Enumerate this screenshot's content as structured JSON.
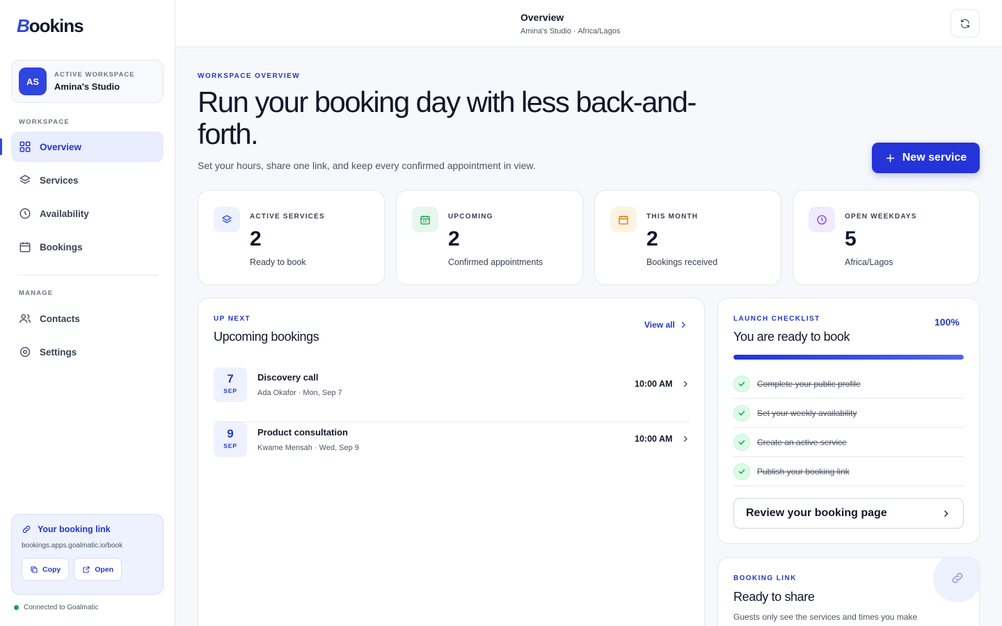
{
  "brand": {
    "name": "ookins",
    "mark": "B"
  },
  "workspace": {
    "initials": "AS",
    "label": "ACTIVE WORKSPACE",
    "name": "Amina's Studio"
  },
  "sidebar": {
    "section_workspace": "WORKSPACE",
    "section_manage": "MANAGE",
    "items": [
      {
        "label": "Overview",
        "icon": "grid-icon",
        "active": true
      },
      {
        "label": "Services",
        "icon": "layers-icon",
        "active": false
      },
      {
        "label": "Availability",
        "icon": "clock-icon",
        "active": false
      },
      {
        "label": "Bookings",
        "icon": "calendar-icon",
        "active": false
      },
      {
        "label": "Contacts",
        "icon": "users-icon",
        "active": false
      },
      {
        "label": "Settings",
        "icon": "gear-icon",
        "active": false
      }
    ]
  },
  "booking_link_card": {
    "title": "Your booking link",
    "url": "bookings.apps.goalmatic.io/book",
    "copy_label": "Copy",
    "open_label": "Open"
  },
  "connection": {
    "status": "Connected to Goalmatic",
    "color": "#16a34a"
  },
  "header": {
    "title": "Overview",
    "subtitle": "Amina's Studio · Africa/Lagos"
  },
  "hero": {
    "eyebrow": "WORKSPACE OVERVIEW",
    "headline": "Run your booking day with less back-and-forth.",
    "subtitle": "Set your hours, share one link, and keep every confirmed appointment in view.",
    "new_service_label": "New service"
  },
  "stats": [
    {
      "label": "ACTIVE SERVICES",
      "value": "2",
      "sub": "Ready to book",
      "icon": "layers-icon",
      "color": "#2f45e0",
      "bg": "#eef1fe"
    },
    {
      "label": "UPCOMING",
      "value": "2",
      "sub": "Confirmed appointments",
      "icon": "calendar-icon",
      "color": "#16a34a",
      "bg": "#e8f7ee"
    },
    {
      "label": "THIS MONTH",
      "value": "2",
      "sub": "Bookings received",
      "icon": "calendar-icon",
      "color": "#d97706",
      "bg": "#fdf3e1"
    },
    {
      "label": "OPEN WEEKDAYS",
      "value": "5",
      "sub": "Africa/Lagos",
      "icon": "clock-icon",
      "color": "#7c3aed",
      "bg": "#f1ebfd"
    }
  ],
  "upcoming": {
    "eyebrow": "UP NEXT",
    "title": "Upcoming bookings",
    "view_all": "View all",
    "rows": [
      {
        "day": "7",
        "month": "SEP",
        "title": "Discovery call",
        "sub": "Ada Okafor · Mon, Sep 7",
        "time": "10:00 AM"
      },
      {
        "day": "9",
        "month": "SEP",
        "title": "Product consultation",
        "sub": "Kwame Mensah · Wed, Sep 9",
        "time": "10:00 AM"
      }
    ]
  },
  "checklist": {
    "eyebrow": "LAUNCH CHECKLIST",
    "title": "You are ready to book",
    "percent_label": "100%",
    "progress": 1.0,
    "items": [
      {
        "label": "Complete your public profile",
        "done": true
      },
      {
        "label": "Set your weekly availability",
        "done": true
      },
      {
        "label": "Create an active service",
        "done": true
      },
      {
        "label": "Publish your booking link",
        "done": true
      }
    ],
    "review_label": "Review your booking page"
  },
  "share": {
    "eyebrow": "BOOKING LINK",
    "title": "Ready to share",
    "sub": "Guests only see the services and times you make"
  },
  "accent": "#2434d8"
}
